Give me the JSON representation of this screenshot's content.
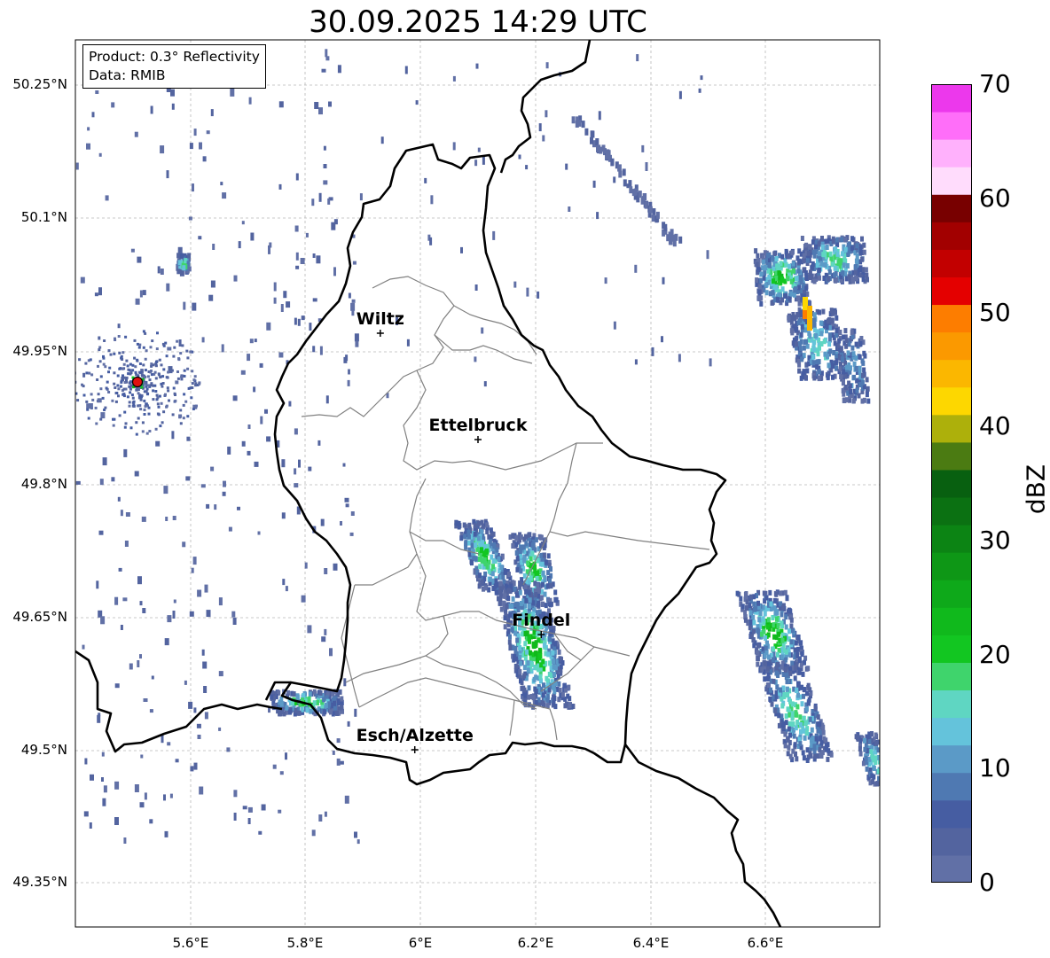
{
  "title": "30.09.2025 14:29 UTC",
  "info": {
    "product": "Product: 0.3° Reflectivity",
    "data": "Data: RMIB"
  },
  "lat_labels": [
    "50.25°N",
    "50.1°N",
    "49.95°N",
    "49.8°N",
    "49.65°N",
    "49.5°N",
    "49.35°N"
  ],
  "lon_labels": [
    "5.6°E",
    "5.8°E",
    "6°E",
    "6.2°E",
    "6.4°E",
    "6.6°E"
  ],
  "cities": [
    {
      "name": "Wiltz",
      "lon": 5.93,
      "lat": 49.97
    },
    {
      "name": "Ettelbruck",
      "lon": 6.1,
      "lat": 49.85
    },
    {
      "name": "Findel",
      "lon": 6.21,
      "lat": 49.63
    },
    {
      "name": "Esch/Alzette",
      "lon": 5.99,
      "lat": 49.5
    }
  ],
  "radar_site": {
    "lon": 5.505,
    "lat": 49.915,
    "color": "#e01010"
  },
  "colorbar": {
    "label": "dBZ",
    "ticks": [
      "0",
      "10",
      "20",
      "30",
      "40",
      "50",
      "60",
      "70"
    ],
    "colors": [
      "#6170a6",
      "#53649f",
      "#465da2",
      "#4f79b2",
      "#5b9ac7",
      "#64c3db",
      "#5fd6c2",
      "#3fd46c",
      "#12c621",
      "#10b91c",
      "#0ea91a",
      "#0e9716",
      "#0c8414",
      "#0b7112",
      "#086010",
      "#4b7b12",
      "#adb00b",
      "#fdd700",
      "#fbb700",
      "#fb9900",
      "#fd7d00",
      "#e40000",
      "#c20000",
      "#a20000",
      "#780000",
      "#ffdcfc",
      "#ffb1fc",
      "#ff6ef9",
      "#ec38ec"
    ]
  },
  "map": {
    "lon_range": [
      5.4,
      6.8
    ],
    "lat_range": [
      49.3,
      50.3
    ],
    "grid": true,
    "lux_border_color": "#000000",
    "canton_border_color": "#808080"
  }
}
